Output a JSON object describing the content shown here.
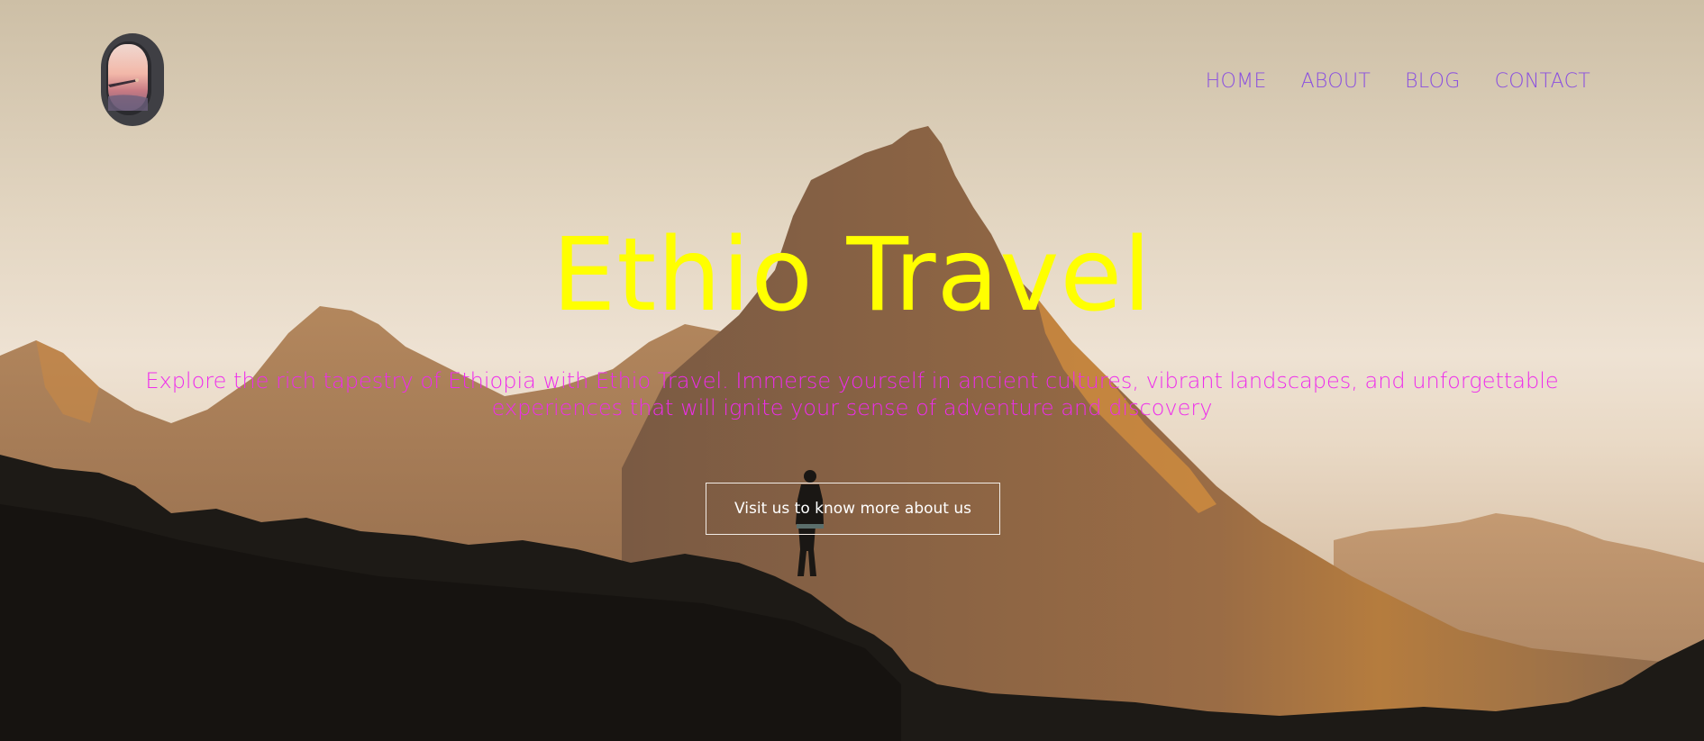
{
  "nav": {
    "items": [
      {
        "label": "HOME"
      },
      {
        "label": "ABOUT"
      },
      {
        "label": "BLOG"
      },
      {
        "label": "CONTACT"
      }
    ]
  },
  "hero": {
    "title": "Ethio Travel",
    "subtitle": "Explore the rich tapestry of Ethiopia with Ethio Travel. Immerse yourself in ancient cultures, vibrant landscapes, and unforgettable experiences that will ignite your sense of adventure and discovery",
    "cta_label": "Visit us to know more about us"
  },
  "colors": {
    "nav_text": "#8a4fe0",
    "title": "#ffff00",
    "subtitle": "#ee2cec",
    "button_border": "#f2ece6"
  },
  "icons": {
    "logo": "airplane-window-icon"
  }
}
